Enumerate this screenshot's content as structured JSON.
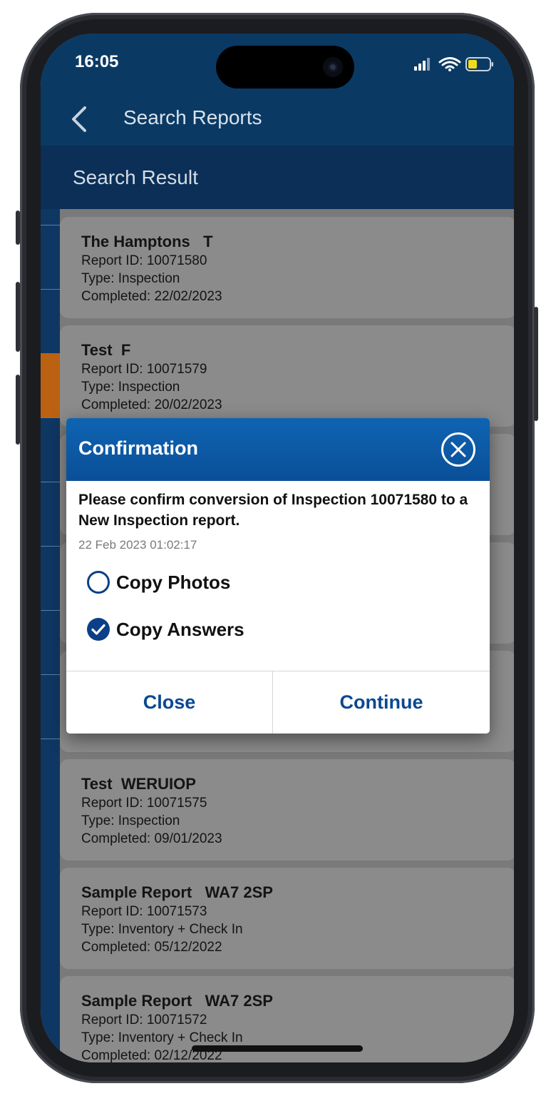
{
  "status_bar": {
    "time": "16:05"
  },
  "nav": {
    "title": "Search Reports"
  },
  "subheader": {
    "title": "Search Result"
  },
  "reports": [
    {
      "title": "The Hamptons   T",
      "report_id": "Report ID: 10071580",
      "type": "Type: Inspection",
      "completed": "Completed: 22/02/2023"
    },
    {
      "title": "Test  F",
      "report_id": "Report ID: 10071579",
      "type": "Type: Inspection",
      "completed": "Completed: 20/02/2023"
    },
    {
      "title": "Test  WERUIOP",
      "report_id": "Report ID: 10071575",
      "type": "Type: Inspection",
      "completed": "Completed: 09/01/2023"
    },
    {
      "title": "Sample Report   WA7 2SP",
      "report_id": "Report ID: 10071573",
      "type": "Type: Inventory + Check In",
      "completed": "Completed: 05/12/2022"
    },
    {
      "title": "Sample Report   WA7 2SP",
      "report_id": "Report ID: 10071572",
      "type": "Type: Inventory + Check In",
      "completed": "Completed: 02/12/2022"
    }
  ],
  "dialog": {
    "title": "Confirmation",
    "message": "Please confirm conversion of Inspection 10071580 to a New Inspection report.",
    "date": "22 Feb 2023 01:02:17",
    "options": [
      {
        "label": "Copy Photos",
        "checked": false
      },
      {
        "label": "Copy Answers",
        "checked": true
      }
    ],
    "close_label": "Close",
    "continue_label": "Continue"
  },
  "colors": {
    "header_bg": "#0a3a64",
    "subheader_bg": "#0b2f57",
    "dialog_header": "#0a4f98",
    "accent_text": "#0b4891",
    "strip_orange": "#ba6212"
  },
  "icons": {
    "back": "chevron-left-icon",
    "close": "close-circle-icon",
    "signal": "cellular-signal-icon",
    "wifi": "wifi-icon",
    "battery": "battery-icon"
  }
}
